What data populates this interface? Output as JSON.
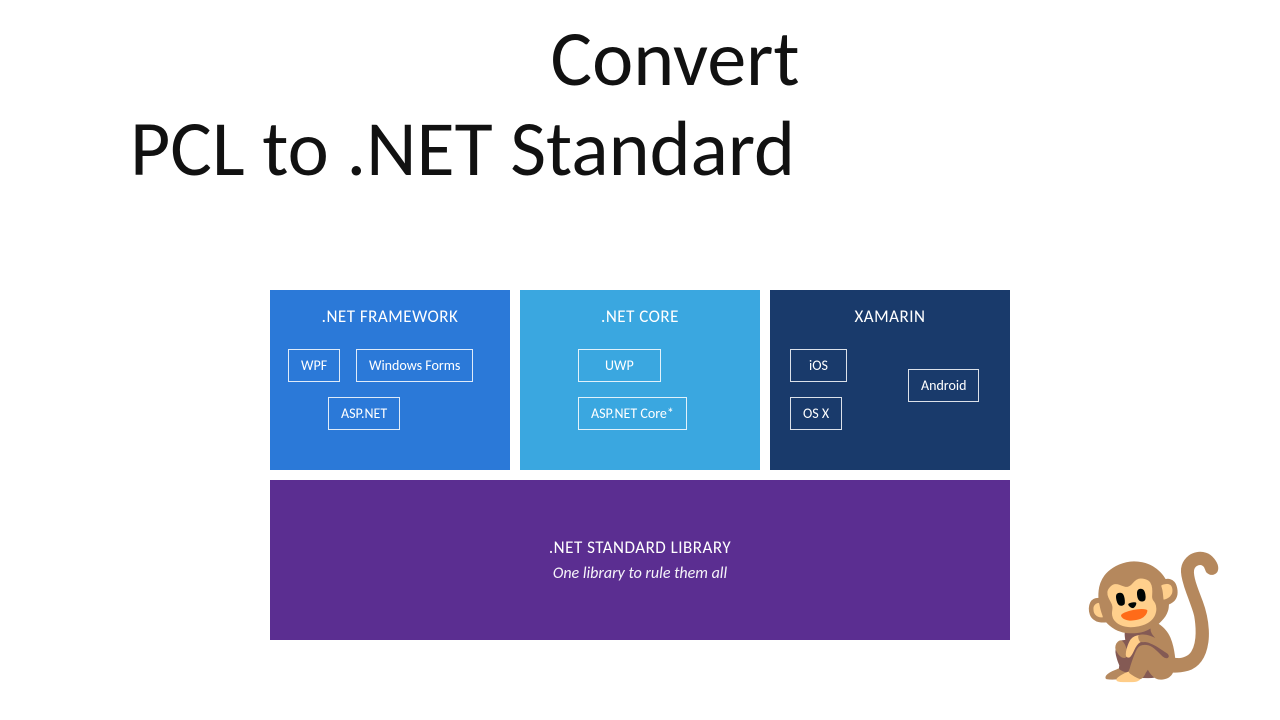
{
  "title": {
    "line1": "Convert",
    "line2": "PCL to .NET Standard"
  },
  "columns": {
    "framework": {
      "header": ".NET FRAMEWORK",
      "chips": {
        "wpf": "WPF",
        "winforms": "Windows Forms",
        "aspnet": "ASP.NET"
      }
    },
    "core": {
      "header": ".NET CORE",
      "chips": {
        "uwp": "UWP",
        "aspnetcore": "ASP.NET Core*"
      }
    },
    "xamarin": {
      "header": "XAMARIN",
      "chips": {
        "ios": "iOS",
        "osx": "OS X",
        "android": "Android"
      }
    }
  },
  "library": {
    "title": ".NET STANDARD LIBRARY",
    "subtitle": "One library to rule them all"
  },
  "decoration": {
    "monkey": "🐒"
  }
}
